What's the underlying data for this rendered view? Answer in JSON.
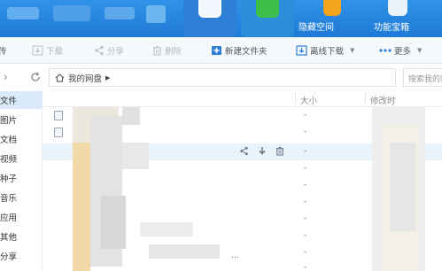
{
  "header": {
    "private_space_label": "隐藏空间",
    "feature_treasure_label": "功能宝箱"
  },
  "toolbar": {
    "upload_label": "传",
    "download_label": "下载",
    "share_label": "分享",
    "delete_label": "删除",
    "new_folder_label": "新建文件夹",
    "offline_download_label": "离线下载",
    "more_label": "更多"
  },
  "address": {
    "path_root": "我的网盘",
    "search_placeholder": "搜索我的网盘"
  },
  "sidebar": {
    "items": [
      {
        "label": "文件",
        "active": true
      },
      {
        "label": "图片",
        "active": false
      },
      {
        "label": "文档",
        "active": false
      },
      {
        "label": "视频",
        "active": false
      },
      {
        "label": "种子",
        "active": false
      },
      {
        "label": "音乐",
        "active": false
      },
      {
        "label": "应用",
        "active": false
      },
      {
        "label": "其他",
        "active": false
      },
      {
        "label": "分享",
        "active": false
      }
    ]
  },
  "list": {
    "columns": {
      "size": "大小",
      "modified": "修改时"
    },
    "rows": [
      {
        "size": "-"
      },
      {
        "size": "-"
      },
      {
        "size": "-"
      },
      {
        "size": "-"
      },
      {
        "size": "-"
      },
      {
        "size": "-"
      },
      {
        "size": "-"
      },
      {
        "size": "-"
      },
      {
        "size": "-"
      },
      {
        "size": "-"
      }
    ],
    "trailing_text": "..."
  },
  "colors": {
    "banner_blue": "#1f7ad6",
    "selection_blue": "#d9ebfb",
    "hover_row": "#e9f3fc"
  }
}
